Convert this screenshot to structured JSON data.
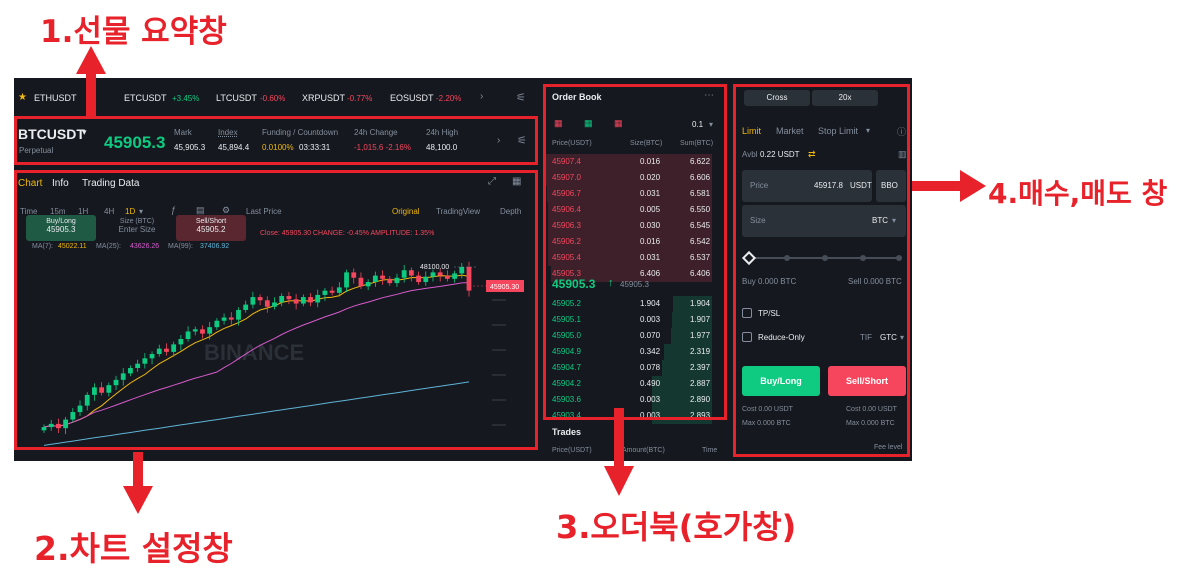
{
  "annotations": {
    "futures_summary": "1.선물 요약창",
    "chart_settings": "2.차트 설정창",
    "orderbook": "3.오더북(호가창)",
    "buy_sell": "4.매수,매도 창"
  },
  "ticker": [
    {
      "symbol": "ETHUSDT",
      "change": ""
    },
    {
      "symbol": "ETCUSDT",
      "change": "+3.45%"
    },
    {
      "symbol": "LTCUSDT",
      "change": "-0.60%"
    },
    {
      "symbol": "XRPUSDT",
      "change": "-0.77%"
    },
    {
      "symbol": "EOSUSDT",
      "change": "-2.20%"
    }
  ],
  "summary": {
    "symbol": "BTCUSDT",
    "subtitle": "Perpetual",
    "price": "45905.3",
    "mark_label": "Mark",
    "mark": "45,905.3",
    "index_label": "Index",
    "index": "45,894.4",
    "funding_label": "Funding / Countdown",
    "funding": "0.0100%",
    "countdown": "03:33:31",
    "change_label": "24h Change",
    "change": "-1,015.6 -2.16%",
    "high_label": "24h High",
    "high": "48,100.0"
  },
  "chart": {
    "tabs": [
      "Chart",
      "Info",
      "Trading Data"
    ],
    "intervals": [
      "Time",
      "15m",
      "1H",
      "4H",
      "1D"
    ],
    "last_price": "Last Price",
    "views": [
      "Original",
      "TradingView",
      "Depth"
    ],
    "buy_long": "Buy/Long",
    "buy_long_price": "45905.3",
    "size_label": "Size (BTC)",
    "size_placeholder": "Enter Size",
    "sell_short": "Sell/Short",
    "sell_short_price": "45905.2",
    "ohlc": "Close: 45905.30  CHANGE: -0.45%  AMPLITUDE: 1.35%",
    "ma7_label": "MA(7):",
    "ma7": "45022.11",
    "ma25_label": "MA(25):",
    "ma25": "43626.26",
    "ma99_label": "MA(99):",
    "ma99": "37406.92",
    "high_marker": "48100.00",
    "price_tag": "45905.30",
    "watermark": "BINANCE"
  },
  "chart_data": {
    "type": "candlestick",
    "close": [
      33200,
      33500,
      33100,
      33900,
      34600,
      35200,
      36200,
      36900,
      36400,
      37100,
      37600,
      38200,
      38700,
      39100,
      39600,
      40000,
      40500,
      40200,
      40900,
      41400,
      42100,
      42300,
      41900,
      42500,
      43100,
      43400,
      43200,
      44100,
      44600,
      45300,
      45000,
      44400,
      44800,
      45400,
      45100,
      44700,
      45300,
      44800,
      45500,
      45900,
      45700,
      46200,
      47600,
      47100,
      46300,
      46700,
      47300,
      47000,
      46600,
      47100,
      47800,
      47300,
      46700,
      47200,
      47600,
      47300,
      47000,
      47500,
      48100,
      45905
    ]
  },
  "orderbook": {
    "title": "Order Book",
    "precision": "0.1",
    "headers": [
      "Price(USDT)",
      "Size(BTC)",
      "Sum(BTC)"
    ],
    "asks": [
      [
        "45907.4",
        "0.016",
        "6.622"
      ],
      [
        "45907.0",
        "0.020",
        "6.606"
      ],
      [
        "45906.7",
        "0.031",
        "6.581"
      ],
      [
        "45906.4",
        "0.005",
        "6.550"
      ],
      [
        "45906.3",
        "0.030",
        "6.545"
      ],
      [
        "45906.2",
        "0.016",
        "6.542"
      ],
      [
        "45905.4",
        "0.031",
        "6.537"
      ],
      [
        "45905.3",
        "6.406",
        "6.406"
      ]
    ],
    "last_price": "45905.3",
    "last_sub": "45905.3",
    "bids": [
      [
        "45905.2",
        "1.904",
        "1.904"
      ],
      [
        "45905.1",
        "0.003",
        "1.907"
      ],
      [
        "45905.0",
        "0.070",
        "1.977"
      ],
      [
        "45904.9",
        "0.342",
        "2.319"
      ],
      [
        "45904.7",
        "0.078",
        "2.397"
      ],
      [
        "45904.2",
        "0.490",
        "2.887"
      ],
      [
        "45903.6",
        "0.003",
        "2.890"
      ],
      [
        "45903.4",
        "0.003",
        "2.893"
      ]
    ],
    "trades_title": "Trades",
    "trades_headers": [
      "Price(USDT)",
      "Amount(BTC)",
      "Time"
    ]
  },
  "order": {
    "margin_mode": "Cross",
    "leverage": "20x",
    "types": [
      "Limit",
      "Market",
      "Stop Limit"
    ],
    "avbl_label": "Avbl",
    "avbl": "0.22 USDT",
    "price_label": "Price",
    "price": "45917.8",
    "price_unit": "USDT",
    "bbo": "BBO",
    "size_label": "Size",
    "size_unit": "BTC",
    "buy_info": "Buy 0.000 BTC",
    "sell_info": "Sell 0.000 BTC",
    "tpsl": "TP/SL",
    "reduce_only": "Reduce-Only",
    "tif_label": "TIF",
    "tif": "GTC",
    "buy_btn": "Buy/Long",
    "sell_btn": "Sell/Short",
    "cost_buy": "Cost 0.00 USDT",
    "cost_sell": "Cost 0.00 USDT",
    "max_buy": "Max 0.000 BTC",
    "max_sell": "Max 0.000 BTC",
    "fee_level": "Fee level"
  },
  "colors": {
    "green": "#0ecb81",
    "red": "#f6465d",
    "annotation": "#e8222a",
    "bg": "#15181f"
  }
}
